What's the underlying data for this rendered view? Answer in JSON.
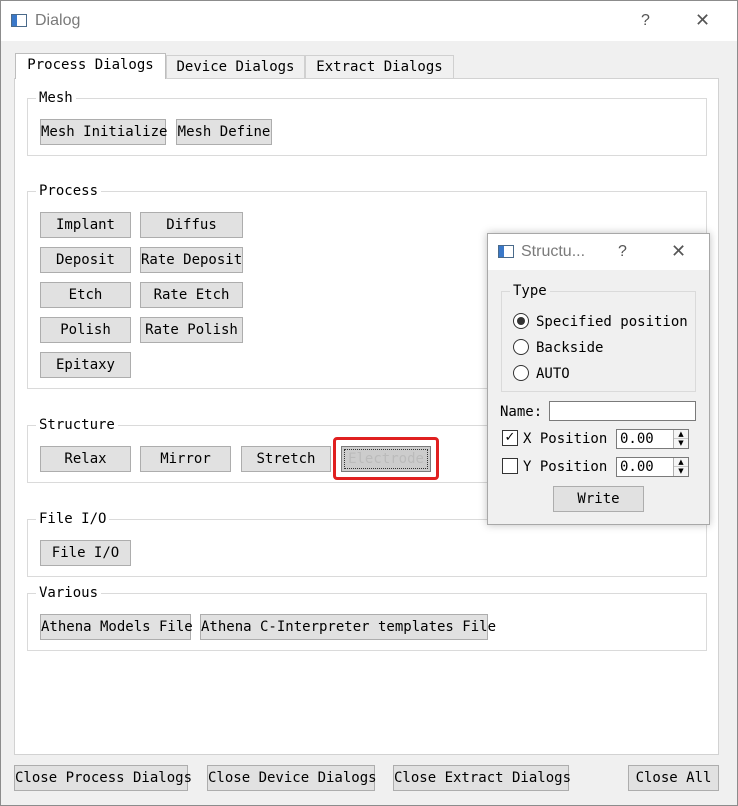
{
  "window": {
    "title": "Dialog",
    "help_glyph": "?",
    "close_glyph": "✕"
  },
  "tabs": [
    {
      "label": "Process Dialogs",
      "active": true
    },
    {
      "label": "Device Dialogs",
      "active": false
    },
    {
      "label": "Extract Dialogs",
      "active": false
    }
  ],
  "groups": {
    "mesh": {
      "title": "Mesh",
      "buttons": [
        "Mesh Initialize",
        "Mesh Define"
      ]
    },
    "process": {
      "title": "Process",
      "buttons": [
        "Implant",
        "Diffus",
        "Deposit",
        "Rate Deposit",
        "Etch",
        "Rate Etch",
        "Polish",
        "Rate Polish",
        "Epitaxy"
      ]
    },
    "structure": {
      "title": "Structure",
      "buttons": [
        "Relax",
        "Mirror",
        "Stretch",
        "Electrode"
      ]
    },
    "fileio": {
      "title": "File I/O",
      "buttons": [
        "File I/O"
      ]
    },
    "various": {
      "title": "Various",
      "buttons": [
        "Athena Models File",
        "Athena C-Interpreter templates File"
      ]
    }
  },
  "footer": {
    "buttons": [
      "Close Process Dialogs",
      "Close Device Dialogs",
      "Close Extract Dialogs",
      "Close All"
    ]
  },
  "child_dialog": {
    "title": "Structu...",
    "help_glyph": "?",
    "close_glyph": "✕",
    "type_group": {
      "title": "Type",
      "options": [
        {
          "label": "Specified position",
          "checked": true
        },
        {
          "label": "Backside",
          "checked": false
        },
        {
          "label": "AUTO",
          "checked": false
        }
      ]
    },
    "name_label": "Name:",
    "name_value": "",
    "x_position": {
      "label": "X Position",
      "checked": true,
      "value": "0.00"
    },
    "y_position": {
      "label": "Y Position",
      "checked": false,
      "value": "0.00"
    },
    "write_button": "Write"
  },
  "colors": {
    "highlight": "#e02020",
    "tab_active_bg": "#ffffff",
    "button_bg": "#e1e1e1"
  }
}
